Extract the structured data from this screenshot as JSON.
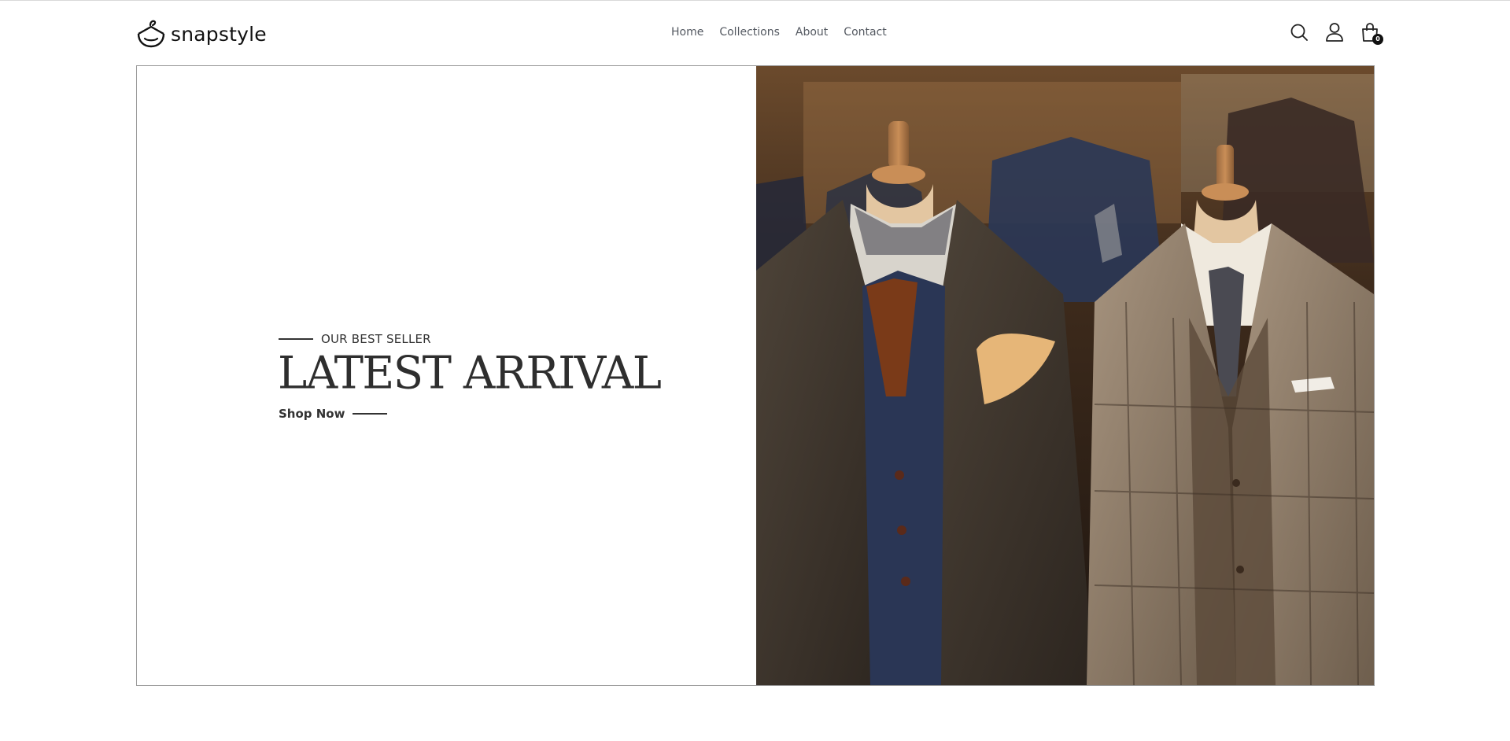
{
  "brand": {
    "name": "snapstyle"
  },
  "nav": {
    "items": [
      {
        "label": "Home"
      },
      {
        "label": "Collections"
      },
      {
        "label": "About"
      },
      {
        "label": "Contact"
      }
    ]
  },
  "header_icons": {
    "search": "search-icon",
    "account": "user-icon",
    "cart": "shopping-bag-icon",
    "cart_count": "0"
  },
  "hero": {
    "eyebrow": "OUR BEST SELLER",
    "headline": "LATEST ARRIVAL",
    "cta_label": "Shop Now",
    "image": "photo of two tailored jackets on wooden mannequins in a menswear store"
  },
  "colors": {
    "text_dark": "#2e2e2e",
    "nav_text": "#555a62",
    "border": "#9a9a9a",
    "background": "#ffffff"
  }
}
